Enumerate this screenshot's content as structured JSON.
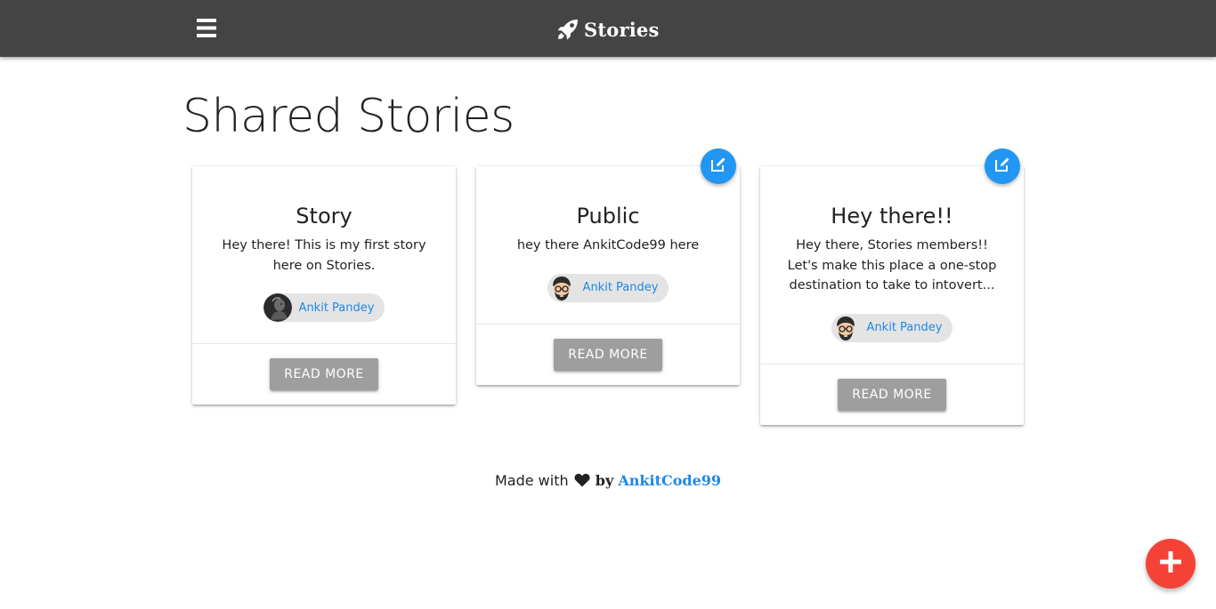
{
  "navbar": {
    "brand": "Stories",
    "menu_icon": "hamburger-menu-icon",
    "brand_icon": "rocket-icon"
  },
  "page": {
    "title": "Shared Stories"
  },
  "stories": [
    {
      "title": "Story",
      "body": "Hey there! This is my first story here on Stories.",
      "author": "Ankit Pandey",
      "avatar": "dark-photo-avatar",
      "read_more": "READ MORE",
      "editable": false
    },
    {
      "title": "Public",
      "body": "hey there AnkitCode99 here",
      "author": "Ankit Pandey",
      "avatar": "bearded-cartoon-avatar",
      "read_more": "READ MORE",
      "editable": true
    },
    {
      "title": "Hey there!!",
      "body": "Hey there, Stories members!! Let's make this place a one-stop destination to take to intovert...",
      "author": "Ankit Pandey",
      "avatar": "bearded-cartoon-avatar",
      "read_more": "READ MORE",
      "editable": true
    }
  ],
  "footer": {
    "made_with": "Made with",
    "by": "by",
    "author": "AnkitCode99"
  },
  "colors": {
    "navbar": "#444444",
    "accent_blue": "#2196f3",
    "link_blue": "#1e88e5",
    "fab_red": "#f44336",
    "button_grey": "#9e9e9e"
  }
}
